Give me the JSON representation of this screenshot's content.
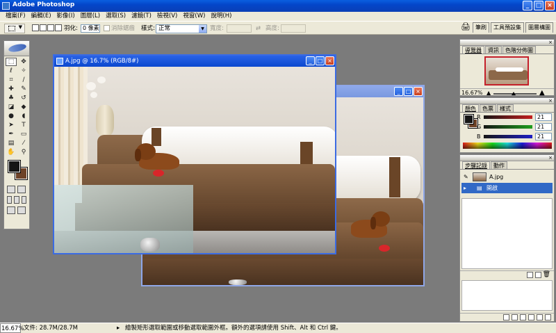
{
  "app": {
    "title": "Adobe Photoshop"
  },
  "menu": [
    "檔案(F)",
    "編輯(E)",
    "影像(I)",
    "圖層(L)",
    "選取(S)",
    "濾鏡(T)",
    "檢視(V)",
    "視窗(W)",
    "說明(H)"
  ],
  "options": {
    "feather_label": "羽化:",
    "feather_value": "0 像素",
    "antialias_label": "消除鋸齒",
    "style_label": "樣式:",
    "style_value": "正常",
    "width_label": "寬度:",
    "height_label": "高度:",
    "wells": [
      "筆刷",
      "工具預設集",
      "圖層構圖"
    ]
  },
  "documents": {
    "front_title": "A.jpg @ 16.7% (RGB/8#)"
  },
  "navigator": {
    "tabs": [
      "導覽器",
      "資訊",
      "色階分佈圖"
    ],
    "zoom": "16.67%",
    "zoom_percent": 16.67
  },
  "color": {
    "tabs": [
      "顏色",
      "色票",
      "樣式"
    ],
    "channels": [
      {
        "label": "R",
        "value": "21",
        "color": "#c41e1e"
      },
      {
        "label": "G",
        "value": "21",
        "color": "#1e9e1e"
      },
      {
        "label": "B",
        "value": "21",
        "color": "#1e1ec4"
      }
    ],
    "foreground": "#151515",
    "background": "#6e4328"
  },
  "history": {
    "tabs": [
      "步驟記錄",
      "動作"
    ],
    "items": [
      {
        "label": "A.jpg",
        "selected": false
      },
      {
        "label": "開啟",
        "selected": true
      }
    ]
  },
  "status": {
    "zoom": "16.67%",
    "doc": "文件: 28.7M/28.7M",
    "tip": "繪製矩形選取範圍或移動選取範圍外框。額外的選項請使用 Shift、Alt 和 Ctrl 鍵。"
  }
}
